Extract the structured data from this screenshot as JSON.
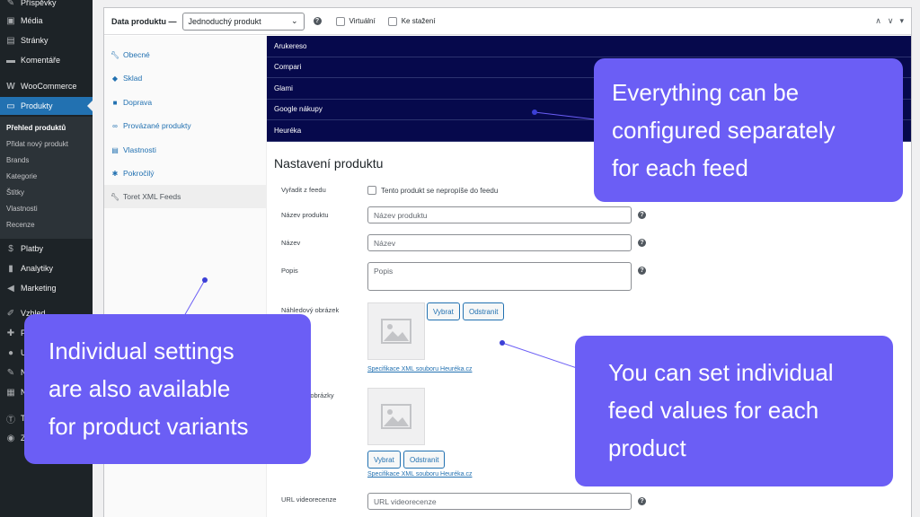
{
  "sidebar": {
    "items": [
      {
        "label": "Příspěvky",
        "icon": "pin-icon"
      },
      {
        "label": "Média",
        "icon": "media-icon"
      },
      {
        "label": "Stránky",
        "icon": "pages-icon"
      },
      {
        "label": "Komentáře",
        "icon": "comments-icon"
      },
      {
        "label": "WooCommerce",
        "icon": "woo-icon"
      },
      {
        "label": "Produkty",
        "icon": "products-icon"
      },
      {
        "label": "Platby",
        "icon": "payments-icon"
      },
      {
        "label": "Analytiky",
        "icon": "analytics-icon"
      },
      {
        "label": "Marketing",
        "icon": "marketing-icon"
      },
      {
        "label": "Vzhled",
        "icon": "appearance-icon"
      },
      {
        "label": "P",
        "icon": "plugins-icon"
      },
      {
        "label": "U",
        "icon": "users-icon"
      },
      {
        "label": "N",
        "icon": "tools-icon"
      },
      {
        "label": "N",
        "icon": "settings-icon"
      },
      {
        "label": "T",
        "icon": "toret-icon"
      },
      {
        "label": "Z",
        "icon": "collapse-icon"
      }
    ],
    "submenu": [
      "Přehled produktů",
      "Přidat nový produkt",
      "Brands",
      "Kategorie",
      "Štítky",
      "Vlastnosti",
      "Recenze"
    ]
  },
  "header": {
    "label": "Data produktu —",
    "type_value": "Jednoduchý produkt",
    "virtual_label": "Virtuální",
    "download_label": "Ke stažení"
  },
  "tabs": [
    {
      "label": "Obecné",
      "icon": "wrench-icon"
    },
    {
      "label": "Sklad",
      "icon": "tag-icon"
    },
    {
      "label": "Doprava",
      "icon": "truck-icon"
    },
    {
      "label": "Provázané produkty",
      "icon": "link-icon"
    },
    {
      "label": "Vlastnosti",
      "icon": "list-icon"
    },
    {
      "label": "Pokročilý",
      "icon": "gear-icon"
    },
    {
      "label": "Toret XML Feeds",
      "icon": "wrench-icon"
    }
  ],
  "feeds": [
    "Arukereso",
    "Compari",
    "Glami",
    "Google nákupy",
    "Heuréka"
  ],
  "settings": {
    "title": "Nastavení produktu",
    "exclude_label": "Vyřadit z feedu",
    "exclude_checkbox": "Tento produkt se nepropíše do feedu",
    "product_name_label": "Název produktu",
    "product_name_placeholder": "Název produktu",
    "name_label": "Název",
    "name_placeholder": "Název",
    "desc_label": "Popis",
    "desc_placeholder": "Popis",
    "preview_image_label": "Náhledový obrázek",
    "select_button": "Vybrat",
    "remove_button": "Odstranit",
    "spec_link": "Specifikace XML souboru Heuréka.cz",
    "other_images_label": "ní obrázky",
    "video_review_label": "URL videorecenze",
    "video_review_placeholder": "URL videorecenze"
  },
  "callouts": {
    "top_right": [
      "Everything can be",
      "configured separately",
      "for each feed"
    ],
    "bottom_left": [
      "Individual settings",
      "are also available",
      "for product variants"
    ],
    "bottom_right": [
      "You can set individual",
      "feed values for each",
      "product"
    ]
  },
  "colors": {
    "feed_bg": "#06094c",
    "callout_bg": "#6b5ef5",
    "accent": "#2271b1",
    "sidebar_bg": "#1d2327"
  }
}
